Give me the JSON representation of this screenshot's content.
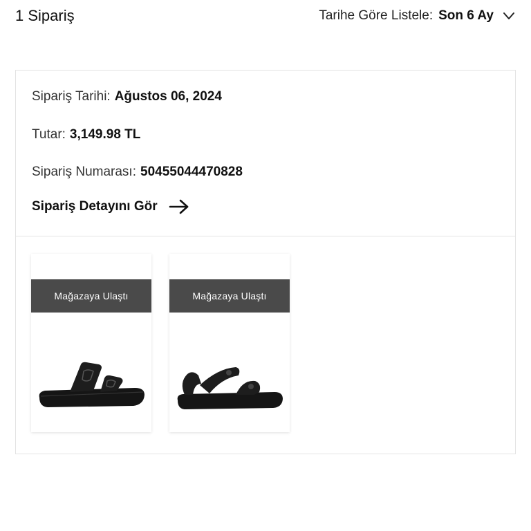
{
  "header": {
    "order_count": "1 Sipariş",
    "sort_label": "Tarihe Göre Listele:",
    "sort_value": "Son 6 Ay",
    "sort_icon": "chevron-down-icon"
  },
  "order": {
    "date_label": "Sipariş Tarihi:",
    "date_value": "Ağustos 06, 2024",
    "amount_label": "Tutar:",
    "amount_value": "3,149.98 TL",
    "number_label": "Sipariş Numarası:",
    "number_value": "50455044470828",
    "detail_link": "Sipariş Detayını Gör",
    "detail_icon": "arrow-right-icon"
  },
  "products": [
    {
      "status": "Mağazaya Ulaştı",
      "image": "black-double-strap-sandal"
    },
    {
      "status": "Mağazaya Ulaştı",
      "image": "black-ankle-strap-sandal"
    }
  ],
  "colors": {
    "status_bar": "#4a4a4a",
    "border": "#e3e3e3",
    "text": "#111111"
  }
}
